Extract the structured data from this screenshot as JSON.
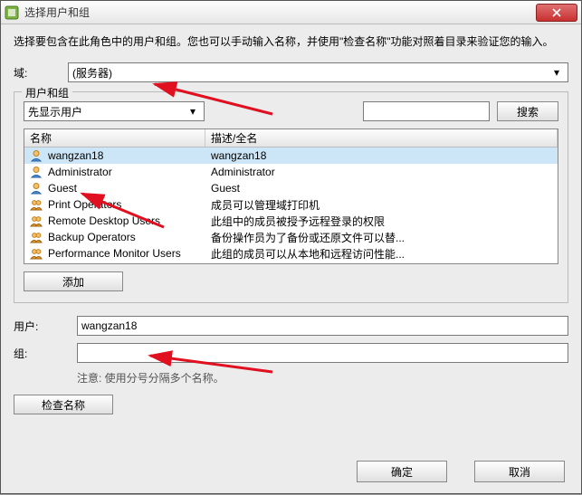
{
  "titlebar": {
    "title": "选择用户和组"
  },
  "instruction": "选择要包含在此角色中的用户和组。您也可以手动输入名称，并使用\"检查名称\"功能对照着目录来验证您的输入。",
  "domain": {
    "label": "域:",
    "value": "(服务器)"
  },
  "users_groups": {
    "legend": "用户和组",
    "filter_label": "先显示用户",
    "search_placeholder": "",
    "search_button": "搜索",
    "columns": {
      "name": "名称",
      "desc": "描述/全名"
    },
    "rows": [
      {
        "name": "wangzan18",
        "desc": "wangzan18",
        "type": "user",
        "selected": true
      },
      {
        "name": "Administrator",
        "desc": "Administrator",
        "type": "user",
        "selected": false
      },
      {
        "name": "Guest",
        "desc": "Guest",
        "type": "user",
        "selected": false
      },
      {
        "name": "Print Operators",
        "desc": "成员可以管理域打印机",
        "type": "group",
        "selected": false
      },
      {
        "name": "Remote Desktop Users",
        "desc": "此组中的成员被授予远程登录的权限",
        "type": "group",
        "selected": false
      },
      {
        "name": "Backup Operators",
        "desc": "备份操作员为了备份或还原文件可以替...",
        "type": "group",
        "selected": false
      },
      {
        "name": "Performance Monitor Users",
        "desc": "此组的成员可以从本地和远程访问性能...",
        "type": "group",
        "selected": false
      }
    ],
    "add_button": "添加"
  },
  "user_field": {
    "label": "用户:",
    "value": "wangzan18"
  },
  "group_field": {
    "label": "组:",
    "value": ""
  },
  "note": "注意: 使用分号分隔多个名称。",
  "check_button": "检查名称",
  "footer": {
    "ok": "确定",
    "cancel": "取消"
  },
  "icons": {
    "app": "vsphere-icon",
    "close": "close-icon",
    "dropdown": "chevron-down-icon"
  },
  "colors": {
    "selection": "#cde6f7",
    "annotation": "#e01020"
  }
}
